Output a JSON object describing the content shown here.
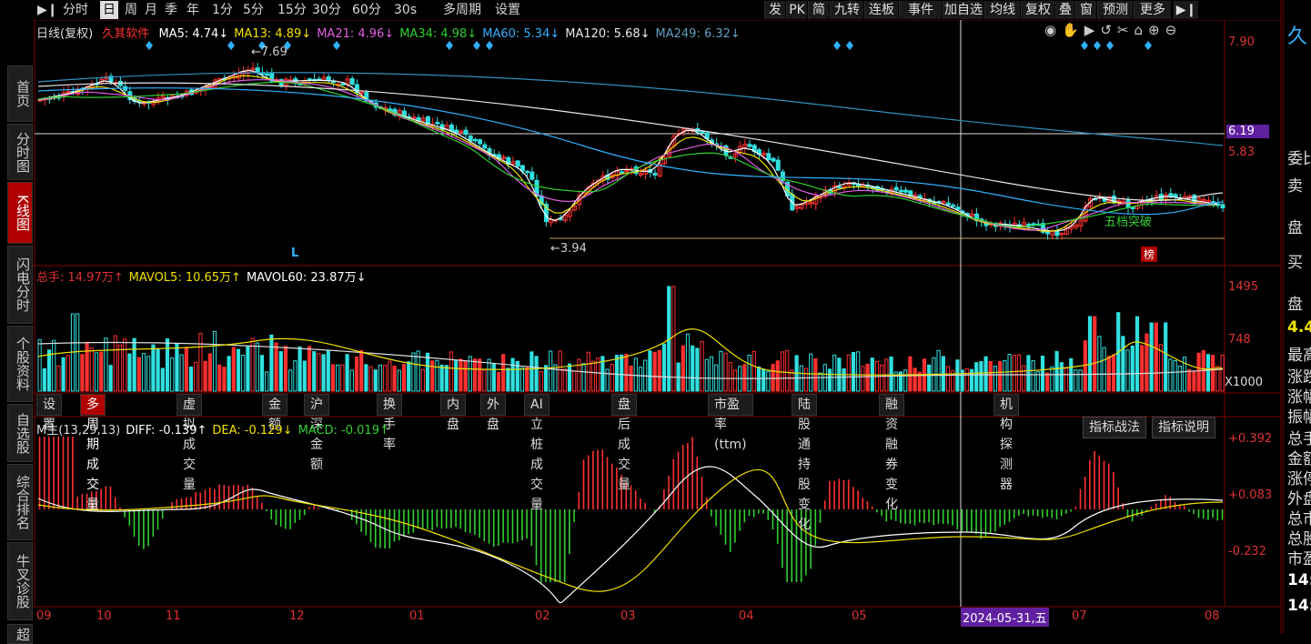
{
  "top_bar": {
    "left_items": [
      "分时",
      "日",
      "周",
      "月",
      "季",
      "年",
      "1分",
      "5分",
      "15分",
      "30分",
      "60分",
      "30s",
      "多周期",
      "设置"
    ],
    "active_index": 1,
    "right_items": [
      "发",
      "PK",
      "简",
      "九转",
      "连板",
      "事件",
      "加自选",
      "均线",
      "复权",
      "叠",
      "窗",
      "预测",
      "更多"
    ]
  },
  "left_nav": [
    "首页",
    "分时图",
    "K线图",
    "闪电分时",
    "个股资料",
    "自选股",
    "综合排名",
    "牛叉诊股",
    "超"
  ],
  "left_nav_active": 2,
  "main_legend": {
    "title": "日线(复权)",
    "stock": "久其软件",
    "ma": [
      {
        "label": "MA5: 4.74↓",
        "color": "#ffffff"
      },
      {
        "label": "MA13: 4.89↓",
        "color": "#f0e000"
      },
      {
        "label": "MA21: 4.96↓",
        "color": "#e060e0"
      },
      {
        "label": "MA34: 4.98↓",
        "color": "#30d030"
      },
      {
        "label": "MA60: 5.34↓",
        "color": "#30b0ff"
      },
      {
        "label": "MA120: 5.68↓",
        "color": "#e8e8e8"
      },
      {
        "label": "MA249: 6.32↓",
        "color": "#60a0c0"
      }
    ]
  },
  "price_axis": [
    "7.90",
    "6.19",
    "5.83"
  ],
  "annotations": {
    "high": "7.69",
    "low": "3.94",
    "marker_l": "L",
    "marker_bang": "榜",
    "pattern": "五档突破"
  },
  "volume_legend": [
    {
      "label": "总手: 14.97万↑",
      "color": "#e03030"
    },
    {
      "label": "MAVOL5: 10.65万↑",
      "color": "#f0e000"
    },
    {
      "label": "MAVOL60: 23.87万↓",
      "color": "#ffffff"
    }
  ],
  "volume_axis": [
    "1495",
    "748",
    "X1000"
  ],
  "indicator_tabs": [
    "设置",
    "多周期成交量",
    "虚拟成交量",
    "金额",
    "沪深金额",
    "换手率",
    "内盘",
    "外盘",
    "AI立桩成交量",
    "盘后成交量",
    "市盈率(ttm)",
    "陆股通持股变化",
    "融资融券变化",
    "机构探测器"
  ],
  "indicator_tab_active": 1,
  "macd_legend": [
    {
      "label": "M主(13,29,13)",
      "color": "#dddddd"
    },
    {
      "label": "DIFF: -0.139↑",
      "color": "#ffffff"
    },
    {
      "label": "DEA: -0.129↓",
      "color": "#f0e000"
    },
    {
      "label": "MACD: -0.019↑",
      "color": "#30d030"
    }
  ],
  "macd_buttons": [
    "指标战法",
    "指标说明"
  ],
  "macd_axis": [
    "+0.392",
    "+0.083",
    "-0.232"
  ],
  "x_axis": [
    "09",
    "10",
    "11",
    "12",
    "01",
    "02",
    "03",
    "04",
    "05",
    "06",
    "07",
    "08"
  ],
  "crosshair_date": "2024-05-31,五",
  "right_panel": {
    "logo": "久",
    "rows": [
      "委比",
      "卖",
      "盘",
      "买",
      "盘",
      "4.4",
      "最高",
      "涨跌",
      "涨幅",
      "振幅",
      "总手",
      "金额",
      "涨停",
      "外盘",
      "总市",
      "总股",
      "市盈",
      "14:",
      "14:"
    ]
  },
  "colors": {
    "up": "#ff3030",
    "down": "#30e0e0",
    "accent": "#b00000",
    "grid": "#7a0000"
  }
}
